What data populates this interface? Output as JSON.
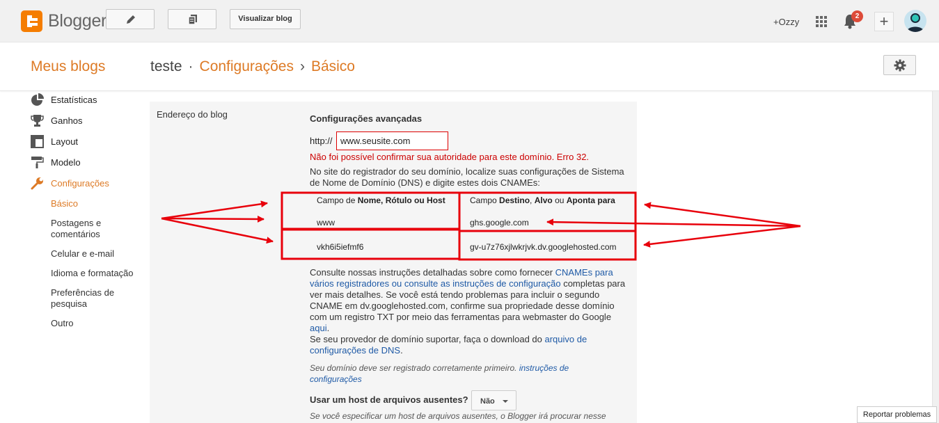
{
  "topbar": {
    "logo": "Blogger",
    "view_blog_label": "Visualizar blog",
    "user_name": "+Ozzy",
    "notification_count": "2",
    "plus_label": "+"
  },
  "header": {
    "my_blogs": "Meus blogs",
    "blog_name": "teste",
    "sep1": "·",
    "crumb1": "Configurações",
    "sep2": "›",
    "crumb2": "Básico"
  },
  "sidebar": {
    "items": [
      {
        "label": "Estatísticas",
        "icon": "stats-pie-icon"
      },
      {
        "label": "Ganhos",
        "icon": "trophy-icon"
      },
      {
        "label": "Layout",
        "icon": "layout-icon"
      },
      {
        "label": "Modelo",
        "icon": "paint-roller-icon"
      },
      {
        "label": "Configurações",
        "icon": "wrench-icon"
      }
    ],
    "subitems": [
      "Básico",
      "Postagens e comentários",
      "Celular e e-mail",
      "Idioma e formatação",
      "Preferências de pesquisa",
      "Outro"
    ]
  },
  "panel": {
    "label": "Endereço do blog",
    "advanced_title": "Configurações avançadas",
    "http_prefix": "http://",
    "domain_value": "www.seusite.com",
    "error": "Não foi possível confirmar sua autoridade para este domínio. Erro 32.",
    "intro": "No site do registrador do seu domínio, localize suas configurações de Sistema de Nome de Domínio (DNS) e digite estes dois CNAMEs:",
    "table": {
      "col1_prefix": "Campo de ",
      "col1_bold": "Nome, Rótulo ou Host",
      "col2_prefix": "Campo ",
      "col2_bold1": "Destino",
      "col2_sep": ", ",
      "col2_bold2": "Alvo",
      "col2_mid": " ou ",
      "col2_bold3": "Aponta para",
      "rows": [
        {
          "name": "www",
          "target": "ghs.google.com"
        },
        {
          "name": "vkh6i5iefmf6",
          "target": "gv-u7z76xjlwkrjvk.dv.googlehosted.com"
        }
      ]
    },
    "help1_a": "Consulte nossas instruções detalhadas sobre como fornecer ",
    "help1_link": "CNAMEs para vários registradores ou consulte as instruções de configuração",
    "help1_b": " completas para ver mais detalhes. Se você está tendo problemas para incluir o segundo CNAME em dv.googlehosted.com, confirme sua propriedade desse domínio com um registro TXT por meio das ferramentas para webmaster do Google ",
    "help1_link2": "aqui",
    "help1_c": ".",
    "help2_a": "Se seu provedor de domínio suportar, faça o download do ",
    "help2_link": "arquivo de configurações de DNS",
    "help2_b": ".",
    "note_a": "Seu domínio deve ser registrado corretamente primeiro. ",
    "note_link": "instruções de configurações",
    "missing_host_q": "Usar um host de arquivos ausentes?",
    "missing_host_value": "Não",
    "missing_host_desc": "Se você especificar um host de arquivos ausentes, o Blogger irá procurar nesse"
  },
  "footer": {
    "report": "Reportar problemas"
  },
  "colors": {
    "accent": "#dd7a25",
    "error": "#cc0000",
    "annotation": "#e8000b",
    "link": "#1f5aa6"
  }
}
